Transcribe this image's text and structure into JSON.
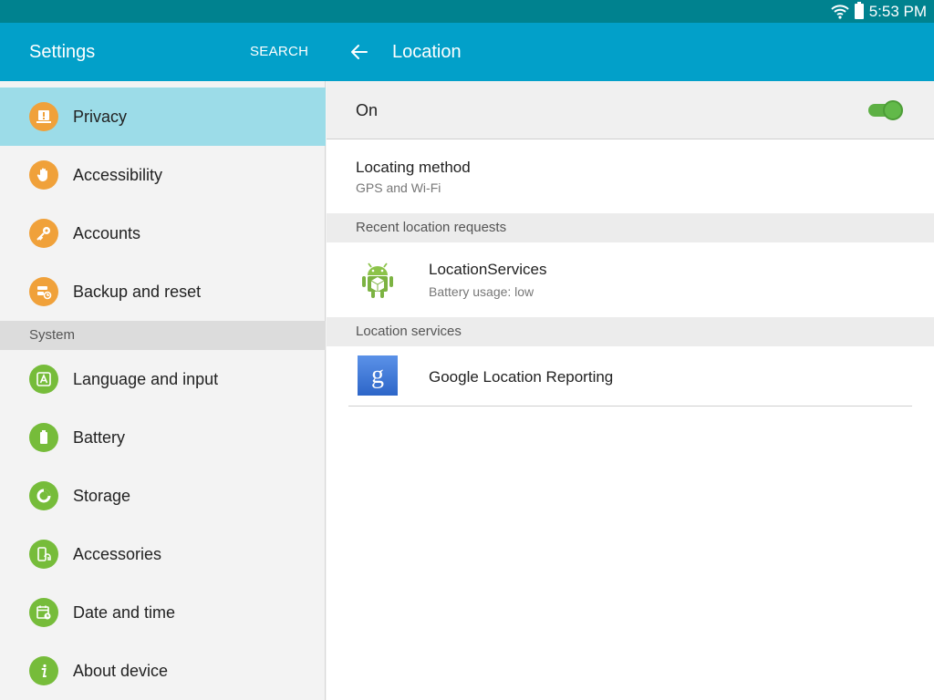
{
  "status": {
    "time": "5:53 PM"
  },
  "header": {
    "settings_title": "Settings",
    "search_label": "SEARCH",
    "page_title": "Location"
  },
  "sidebar": {
    "items": [
      {
        "label": "Privacy",
        "icon": "privacy-icon"
      },
      {
        "label": "Accessibility",
        "icon": "hand-icon"
      },
      {
        "label": "Accounts",
        "icon": "key-icon"
      },
      {
        "label": "Backup and reset",
        "icon": "backup-icon"
      }
    ],
    "system_header": "System",
    "system_items": [
      {
        "label": "Language and input",
        "icon": "language-icon"
      },
      {
        "label": "Battery",
        "icon": "battery-icon"
      },
      {
        "label": "Storage",
        "icon": "storage-icon"
      },
      {
        "label": "Accessories",
        "icon": "accessories-icon"
      },
      {
        "label": "Date and time",
        "icon": "calendar-icon"
      },
      {
        "label": "About device",
        "icon": "info-icon"
      }
    ]
  },
  "location": {
    "on_label": "On",
    "toggle_on": true,
    "method_title": "Locating method",
    "method_value": "GPS and Wi-Fi",
    "recent_header": "Recent location requests",
    "recent_app_name": "LocationServices",
    "recent_app_usage": "Battery usage: low",
    "services_header": "Location services",
    "service_name": "Google Location Reporting"
  },
  "colors": {
    "statusbar": "#00828f",
    "header": "#02a0c9",
    "active_item": "#9cdce8",
    "orange_icon": "#f0a13a",
    "green_icon": "#76bc3a",
    "toggle_on": "#62b949"
  }
}
